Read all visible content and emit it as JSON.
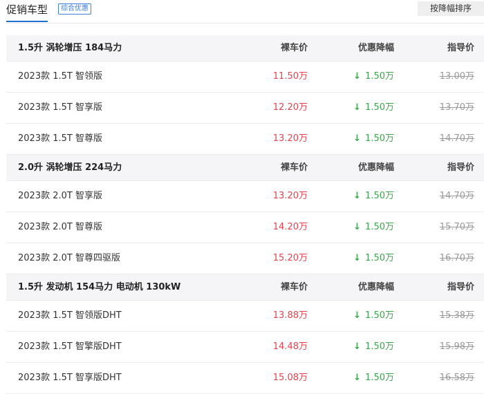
{
  "header": {
    "title": "促销车型",
    "tag": "综合优惠",
    "sort_button": "按降幅排序"
  },
  "groups": [
    {
      "engine": "1.5升 涡轮增压 184马力",
      "col_price": "裸车价",
      "col_discount": "优惠降幅",
      "col_guide": "指导价",
      "rows": [
        {
          "name": "2023款 1.5T 智领版",
          "price": "11.50万",
          "discount": "1.50万",
          "guide": "13.00万"
        },
        {
          "name": "2023款 1.5T 智享版",
          "price": "12.20万",
          "discount": "1.50万",
          "guide": "13.70万"
        },
        {
          "name": "2023款 1.5T 智尊版",
          "price": "13.20万",
          "discount": "1.50万",
          "guide": "14.70万"
        }
      ]
    },
    {
      "engine": "2.0升 涡轮增压 224马力",
      "col_price": "裸车价",
      "col_discount": "优惠降幅",
      "col_guide": "指导价",
      "rows": [
        {
          "name": "2023款 2.0T 智享版",
          "price": "13.20万",
          "discount": "1.50万",
          "guide": "14.70万"
        },
        {
          "name": "2023款 2.0T 智尊版",
          "price": "14.20万",
          "discount": "1.50万",
          "guide": "15.70万"
        },
        {
          "name": "2023款 2.0T 智尊四驱版",
          "price": "15.20万",
          "discount": "1.50万",
          "guide": "16.70万"
        }
      ]
    },
    {
      "engine": "1.5升 发动机 154马力 电动机 130kW",
      "col_price": "裸车价",
      "col_discount": "优惠降幅",
      "col_guide": "指导价",
      "rows": [
        {
          "name": "2023款 1.5T 智领版DHT",
          "price": "13.88万",
          "discount": "1.50万",
          "guide": "15.38万"
        },
        {
          "name": "2023款 1.5T 智擎版DHT",
          "price": "14.48万",
          "discount": "1.50万",
          "guide": "15.98万"
        },
        {
          "name": "2023款 1.5T 智享版DHT",
          "price": "15.08万",
          "discount": "1.50万",
          "guide": "16.58万"
        }
      ]
    }
  ],
  "icons": {
    "discount_arrow": "arrow-down-icon"
  },
  "colors": {
    "price": "#e9414d",
    "discount": "#3fa34d",
    "guide": "#999999",
    "accent": "#1f6fd1"
  }
}
